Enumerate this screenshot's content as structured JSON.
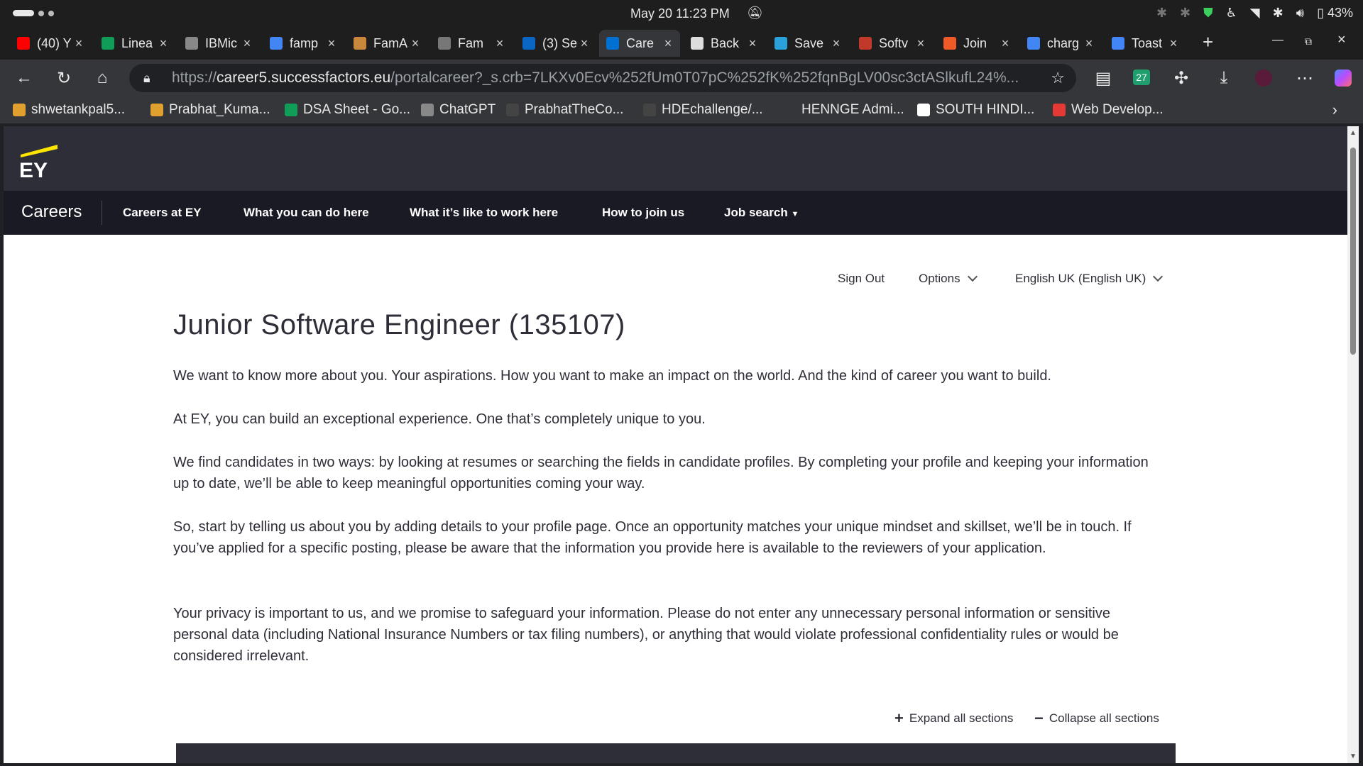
{
  "os": {
    "clock": "May 20  11:23 PM",
    "battery": "43%"
  },
  "tabs": [
    {
      "title": "(40) Y",
      "favicon_color": "#ff0000",
      "favicon": "youtube-icon"
    },
    {
      "title": "Linea",
      "favicon_color": "#0f9d58",
      "favicon": "plus-icon"
    },
    {
      "title": "IBMic",
      "favicon_color": "#888888",
      "favicon": "ibm-icon"
    },
    {
      "title": "famp",
      "favicon_color": "#4285f4",
      "favicon": "google-icon"
    },
    {
      "title": "FamA",
      "favicon_color": "#c8873a",
      "favicon": "famapp-icon"
    },
    {
      "title": "Fam",
      "favicon_color": "#777777",
      "favicon": "feather-icon"
    },
    {
      "title": "(3) Se",
      "favicon_color": "#0a66c2",
      "favicon": "linkedin-icon"
    },
    {
      "title": "Care",
      "favicon_color": "#0070d2",
      "favicon": "successfactors-icon",
      "active": true
    },
    {
      "title": "Back",
      "favicon_color": "#dddddd",
      "favicon": "openai-icon"
    },
    {
      "title": "Save",
      "favicon_color": "#2aa1da",
      "favicon": "telegram-icon"
    },
    {
      "title": "Softv",
      "favicon_color": "#c0392b",
      "favicon": "adobe-icon"
    },
    {
      "title": "Join",
      "favicon_color": "#f05a28",
      "favicon": "codechef-icon"
    },
    {
      "title": "charg",
      "favicon_color": "#4285f4",
      "favicon": "google-icon"
    },
    {
      "title": "Toast",
      "favicon_color": "#4285f4",
      "favicon": "google-icon"
    }
  ],
  "toolbar": {
    "url_scheme": "https://",
    "url_host": "career5.successfactors.eu",
    "url_rest": "/portalcareer?_s.crb=7LKXv0Ecv%252fUm0T07pC%252fK%252fqnBgLV00sc3ctASlkufL24%...",
    "extension_badge": "27"
  },
  "bookmarks": [
    {
      "label": "shwetankpal5...",
      "icon": "codeforces-icon"
    },
    {
      "label": "Prabhat_Kuma...",
      "icon": "codeforces-icon"
    },
    {
      "label": "DSA Sheet - Go...",
      "icon": "sheets-icon"
    },
    {
      "label": "ChatGPT",
      "icon": "openai-icon"
    },
    {
      "label": "PrabhatTheCo...",
      "icon": "github-icon"
    },
    {
      "label": "HDEchallenge/...",
      "icon": "github-icon"
    },
    {
      "label": "HENNGE Admi...",
      "icon": "hennge-icon"
    },
    {
      "label": "SOUTH HINDI...",
      "icon": "page-icon"
    },
    {
      "label": "Web Develop...",
      "icon": "webdev-icon"
    }
  ],
  "site": {
    "brand": "EY",
    "nav": {
      "careers": "Careers",
      "links": [
        "Careers at EY",
        "What you can do here",
        "What it’s like to work here",
        "How to join us",
        "Job search"
      ]
    },
    "utility": {
      "sign_out": "Sign Out",
      "options": "Options",
      "language": "English UK (English UK)"
    },
    "job_title": "Junior Software Engineer (135107)",
    "paragraphs": [
      "We want to know more about you. Your aspirations. How you want to make an impact on the world. And the kind of career you want to build.",
      "At EY, you can build an exceptional experience. One that’s completely unique to you.",
      "We find candidates in two ways: by looking at resumes or searching the fields in candidate profiles. By completing your profile and keeping your information up to date, we’ll be able to keep meaningful opportunities coming your way.",
      "So, start by telling us about you by adding details to your profile page. Once an opportunity matches your unique mindset and skillset, we’ll be in touch. If you’ve applied for a specific posting, please be aware that the information you provide here is available to the reviewers of your application.",
      "Your privacy is important to us, and we promise to safeguard your information. Please do not enter any unnecessary personal information or sensitive personal data (including National Insurance Numbers or tax filing numbers), or anything that would violate professional confidentiality rules or would be considered irrelevant."
    ],
    "expand_all": "Expand all sections",
    "collapse_all": "Collapse all sections",
    "colors": {
      "header_bg": "#2e2e38",
      "nav_bg": "#1a1a24",
      "ey_yellow": "#ffe600"
    }
  }
}
